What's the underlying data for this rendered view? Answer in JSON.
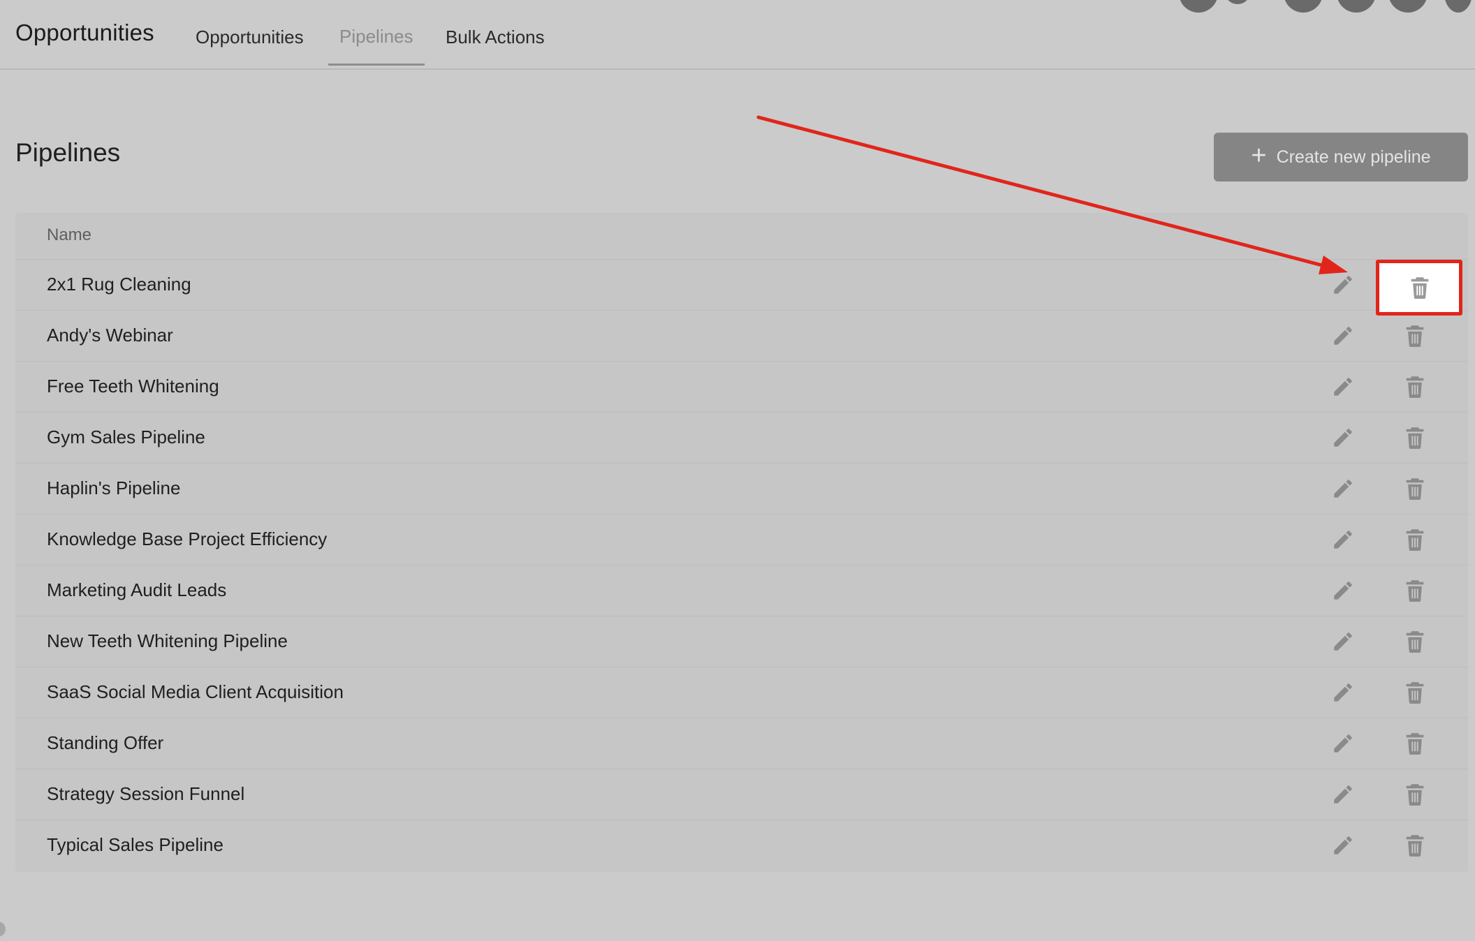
{
  "header": {
    "app_title": "Opportunities",
    "tabs": [
      {
        "label": "Opportunities",
        "active": false
      },
      {
        "label": "Pipelines",
        "active": true
      },
      {
        "label": "Bulk Actions",
        "active": false
      }
    ]
  },
  "page": {
    "title": "Pipelines",
    "create_button_label": "Create new pipeline",
    "create_button_icon": "plus-icon"
  },
  "table": {
    "column_name_header": "Name",
    "rows": [
      {
        "name": "2x1 Rug Cleaning"
      },
      {
        "name": "Andy's Webinar"
      },
      {
        "name": "Free Teeth Whitening"
      },
      {
        "name": "Gym Sales Pipeline"
      },
      {
        "name": "Haplin's Pipeline"
      },
      {
        "name": "Knowledge Base Project Efficiency"
      },
      {
        "name": "Marketing Audit Leads"
      },
      {
        "name": "New Teeth Whitening Pipeline"
      },
      {
        "name": "SaaS Social Media Client Acquisition"
      },
      {
        "name": "Standing Offer"
      },
      {
        "name": "Strategy Session Funnel"
      },
      {
        "name": "Typical Sales Pipeline"
      }
    ],
    "row_actions": [
      "pencil-icon",
      "trash-icon"
    ]
  },
  "annotation": {
    "highlight_color": "#e1251b",
    "highlighted_target": "trash-icon of row 1"
  },
  "colors": {
    "background": "#cbcbcb",
    "button_bg": "#858585",
    "tab_active": "#8b8b8b",
    "icon": "#8a8a8a"
  }
}
